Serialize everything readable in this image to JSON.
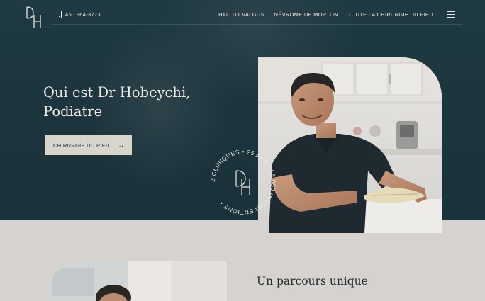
{
  "header": {
    "logo_letters": "DH",
    "phone": "450 964-3773",
    "nav": [
      "HALLUX VALGUS",
      "NÉVROME DE MORTON",
      "TOUTE LA CHIRURGIE DU PIED"
    ],
    "icons": {
      "phone": "phone-icon",
      "menu": "hamburger-menu-icon"
    }
  },
  "hero": {
    "title_line1": "Qui est Dr Hobeychi,",
    "title_line2": "Podiatre",
    "button_label": "CHIRURGIE DU PIED",
    "button_icon": "arrow-right-icon",
    "badge_text": "2 CLINIQUES • 25 ANS • 15,000 INTERVENTIONS • ",
    "badge_letters": "DH"
  },
  "section": {
    "title": "Un parcours unique"
  },
  "colors": {
    "hero_bg": "#1f3a42",
    "page_bg": "#d6d3ce",
    "button_bg": "#d9d5cd",
    "text_light": "#ede9e2",
    "text_dark": "#1f2a2e"
  }
}
